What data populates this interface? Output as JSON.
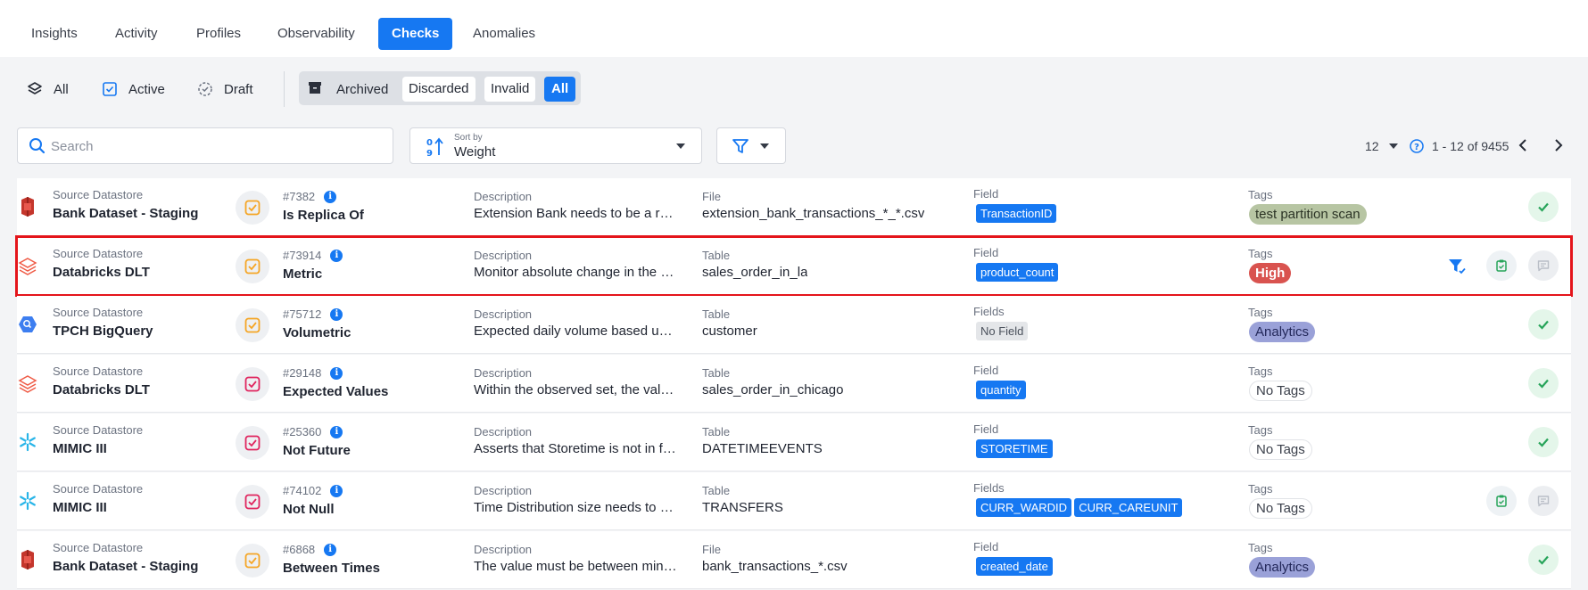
{
  "tabs": [
    {
      "label": "Insights",
      "active": false
    },
    {
      "label": "Activity",
      "active": false
    },
    {
      "label": "Profiles",
      "active": false
    },
    {
      "label": "Observability",
      "active": false
    },
    {
      "label": "Checks",
      "active": true
    },
    {
      "label": "Anomalies",
      "active": false
    }
  ],
  "status_filters": {
    "all": "All",
    "active": "Active",
    "draft": "Draft",
    "archived": "Archived",
    "discarded": "Discarded",
    "invalid": "Invalid",
    "archived_all": "All",
    "archived_selected": "All"
  },
  "search": {
    "placeholder": "Search",
    "value": ""
  },
  "sort": {
    "label": "Sort by",
    "value": "Weight"
  },
  "pagination": {
    "page_size": "12",
    "range": "1 - 12 of 9455"
  },
  "colors": {
    "accent": "#1678f2",
    "highlight_border": "#e4151b",
    "tag_high": "#d9534f",
    "tag_analytics": "#9aa1d8",
    "tag_test": "#b7c5a3",
    "ok_green": "#27a45a"
  },
  "rows": [
    {
      "source_label": "Source Datastore",
      "datastore": "Bank Dataset - Staging",
      "datastore_icon": "aws-s3-icon",
      "check_id": "#7382",
      "check_type": "Is Replica Of",
      "check_icon": "check-square-icon-yellow",
      "description_label": "Description",
      "description": "Extension Bank needs to be a replica of Bank Dataset",
      "location_label": "File",
      "location": "extension_bank_transactions_*_*.csv",
      "field_label": "Field",
      "fields": [
        "TransactionID"
      ],
      "tags_label": "Tags",
      "tags": [
        "test partition scan"
      ],
      "tag_style": "test",
      "status": "active"
    },
    {
      "source_label": "Source Datastore",
      "datastore": "Databricks DLT",
      "datastore_icon": "databricks-icon",
      "check_id": "#73914",
      "check_type": "Metric",
      "check_icon": "check-square-icon-yellow",
      "description_label": "Description",
      "description": "Monitor absolute change in the metric value",
      "location_label": "Table",
      "location": "sales_order_in_la",
      "field_label": "Field",
      "fields": [
        "product_count"
      ],
      "tags_label": "Tags",
      "tags": [
        "High"
      ],
      "tag_style": "high",
      "status": "hover"
    },
    {
      "source_label": "Source Datastore",
      "datastore": "TPCH BigQuery",
      "datastore_icon": "bigquery-icon",
      "check_id": "#75712",
      "check_type": "Volumetric",
      "check_icon": "check-square-icon-yellow",
      "description_label": "Description",
      "description": "Expected daily volume based upon history",
      "location_label": "Table",
      "location": "customer",
      "field_label": "Fields",
      "fields": [
        "No Field"
      ],
      "fields_none": true,
      "tags_label": "Tags",
      "tags": [
        "Analytics"
      ],
      "tag_style": "analytics",
      "status": "active"
    },
    {
      "source_label": "Source Datastore",
      "datastore": "Databricks DLT",
      "datastore_icon": "databricks-icon",
      "check_id": "#29148",
      "check_type": "Expected Values",
      "check_icon": "check-square-icon-pink",
      "description_label": "Description",
      "description": "Within the observed set, the values are expected",
      "location_label": "Table",
      "location": "sales_order_in_chicago",
      "field_label": "Field",
      "fields": [
        "quantity"
      ],
      "tags_label": "Tags",
      "tags": [
        "No Tags"
      ],
      "tag_style": "none",
      "status": "active"
    },
    {
      "source_label": "Source Datastore",
      "datastore": "MIMIC III",
      "datastore_icon": "snowflake-icon",
      "check_id": "#25360",
      "check_type": "Not Future",
      "check_icon": "check-square-icon-pink",
      "description_label": "Description",
      "description": "Asserts that Storetime is not in future",
      "location_label": "Table",
      "location": "DATETIMEEVENTS",
      "field_label": "Field",
      "fields": [
        "STORETIME"
      ],
      "tags_label": "Tags",
      "tags": [
        "No Tags"
      ],
      "tag_style": "none",
      "status": "active"
    },
    {
      "source_label": "Source Datastore",
      "datastore": "MIMIC III",
      "datastore_icon": "snowflake-icon",
      "check_id": "#74102",
      "check_type": "Not Null",
      "check_icon": "check-square-icon-pink",
      "description_label": "Description",
      "description": "Time Distribution size needs to be between values",
      "location_label": "Table",
      "location": "TRANSFERS",
      "field_label": "Fields",
      "fields": [
        "CURR_WARDID",
        "CURR_CAREUNIT"
      ],
      "tags_label": "Tags",
      "tags": [
        "No Tags"
      ],
      "tag_style": "none",
      "status": "draft"
    },
    {
      "source_label": "Source Datastore",
      "datastore": "Bank Dataset - Staging",
      "datastore_icon": "aws-s3-icon",
      "check_id": "#6868",
      "check_type": "Between Times",
      "check_icon": "check-square-icon-yellow",
      "description_label": "Description",
      "description": "The value must be between minTime and maxTime",
      "location_label": "File",
      "location": "bank_transactions_*.csv",
      "field_label": "Field",
      "fields": [
        "created_date"
      ],
      "tags_label": "Tags",
      "tags": [
        "Analytics"
      ],
      "tag_style": "analytics",
      "status": "active"
    }
  ]
}
